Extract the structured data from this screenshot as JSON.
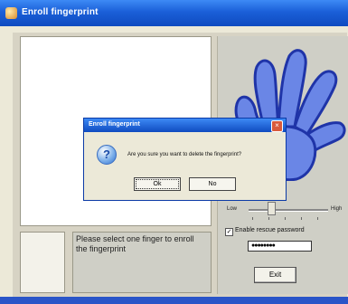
{
  "window": {
    "title": "Enroll fingerprint"
  },
  "settings": {
    "slider_low": "Low",
    "slider_high": "High",
    "rescue_checked": true,
    "rescue_label": "Enable rescue password",
    "password_value": "●●●●●●●●",
    "exit_label": "Exit"
  },
  "instruction": {
    "text": "Please select one finger to enroll the fingerprint"
  },
  "dialog": {
    "title": "Enroll fingerprint",
    "message": "Are you sure you want to delete the fingerprint?",
    "ok_label": "Ok",
    "no_label": "No",
    "close_glyph": "×",
    "icon": "question-icon"
  },
  "colors": {
    "titlebar": "#1a5fd8",
    "hand_fill": "#6a86e6",
    "hand_stroke": "#1f34a8"
  }
}
